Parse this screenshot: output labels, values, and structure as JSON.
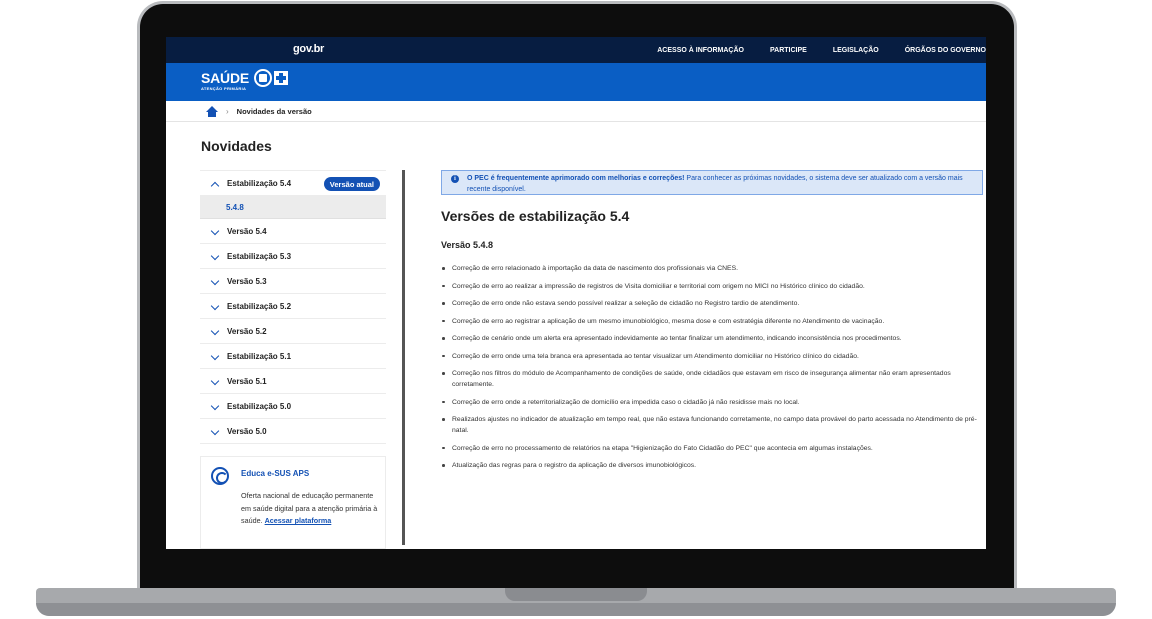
{
  "govbar": {
    "logo": "gov.br",
    "links": [
      "ACESSO À INFORMAÇÃO",
      "PARTICIPE",
      "LEGISLAÇÃO",
      "ÓRGÃOS DO GOVERNO"
    ]
  },
  "brand": {
    "title": "SAÚDE",
    "subtitle": "ATENÇÃO PRIMÁRIA"
  },
  "breadcrumb": {
    "separator": "›",
    "current": "Novidades da versão"
  },
  "page": {
    "title": "Novidades"
  },
  "sidebar": {
    "items": [
      {
        "label": "Estabilização 5.4",
        "expanded": true,
        "badge": "Versão atual"
      },
      {
        "label": "Versão 5.4"
      },
      {
        "label": "Estabilização 5.3"
      },
      {
        "label": "Versão 5.3"
      },
      {
        "label": "Estabilização 5.2"
      },
      {
        "label": "Versão 5.2"
      },
      {
        "label": "Estabilização 5.1"
      },
      {
        "label": "Versão 5.1"
      },
      {
        "label": "Estabilização 5.0"
      },
      {
        "label": "Versão 5.0"
      }
    ],
    "active_sub": "5.4.8",
    "educa": {
      "title": "Educa e-SUS APS",
      "text": "Oferta nacional de educação permanente em saúde digital para a atenção primária à saúde.",
      "link": "Acessar plataforma"
    }
  },
  "main": {
    "info_strong": "O PEC é frequentemente aprimorado com melhorias e correções!",
    "info_text": "Para conhecer as próximas novidades, o sistema deve ser atualizado com a versão mais recente disponível.",
    "section_title": "Versões de estabilização 5.4",
    "version_title": "Versão 5.4.8",
    "notes": [
      "Correção de erro relacionado à importação da data de nascimento dos profissionais via CNES.",
      "Correção de erro ao realizar a impressão de registros de Visita domiciliar e territorial com origem no MICI no Histórico clínico do cidadão.",
      "Correção de erro onde não estava sendo possível realizar a seleção de cidadão no Registro tardio de atendimento.",
      "Correção de erro ao registrar a aplicação de um mesmo imunobiológico, mesma dose e com estratégia diferente no Atendimento de vacinação.",
      "Correção de cenário onde um alerta era apresentado indevidamente ao tentar finalizar um atendimento, indicando inconsistência nos procedimentos.",
      "Correção de erro onde uma tela branca era apresentada ao tentar visualizar um Atendimento domiciliar no Histórico clínico do cidadão.",
      "Correção nos filtros do módulo de Acompanhamento de condições de saúde, onde cidadãos que estavam em risco de insegurança alimentar não eram apresentados corretamente.",
      "Correção de erro onde a reterritorialização de domicílio era impedida caso o cidadão já não residisse mais no local.",
      "Realizados ajustes no indicador de atualização em tempo real, que não estava funcionando corretamente, no campo data provável do parto acessada no Atendimento de pré-natal.",
      "Correção de erro no processamento de relatórios na etapa \"Higienização do Fato Cidadão do PEC\" que acontecia em algumas instalações.",
      "Atualização das regras para o registro da aplicação de diversos imunobiológicos."
    ]
  }
}
